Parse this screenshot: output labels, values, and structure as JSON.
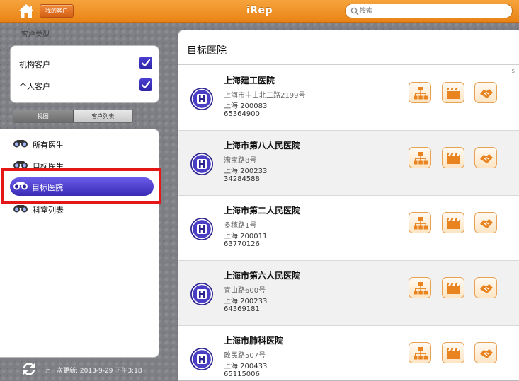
{
  "topbar": {
    "my_customers_label": "我的客户",
    "app_title": "iRep",
    "search_placeholder": "搜索"
  },
  "sidebar": {
    "section_label": "客户类型",
    "customer_types": [
      {
        "label": "机构客户",
        "checked": true
      },
      {
        "label": "个人客户",
        "checked": true
      }
    ],
    "segments": [
      "视图",
      "客户列表"
    ],
    "selected_segment": "视图",
    "nav_items": [
      {
        "label": "所有医生",
        "active": false
      },
      {
        "label": "目标医生",
        "active": false
      },
      {
        "label": "目标医院",
        "active": true
      },
      {
        "label": "科室列表",
        "active": false
      }
    ],
    "last_updated": "上一次更新: 2013-9-29 下午3:18"
  },
  "main": {
    "title": "目标医院",
    "index_marker": "S",
    "hospitals": [
      {
        "name": "上海建工医院",
        "address": "上海市中山北二路2199号",
        "city": "上海 200083",
        "phone": "65364900"
      },
      {
        "name": "上海市第八人民医院",
        "address": "漕宝路8号",
        "city": "上海 200233",
        "phone": "34284588"
      },
      {
        "name": "上海市第二人民医院",
        "address": "多稼路1号",
        "city": "上海 200011",
        "phone": "63770126"
      },
      {
        "name": "上海市第六人民医院",
        "address": "宜山路600号",
        "city": "上海 200233",
        "phone": "64369181"
      },
      {
        "name": "上海市肺科医院",
        "address": "政民路507号",
        "city": "上海 200433",
        "phone": "65115006"
      }
    ]
  },
  "colors": {
    "topbar": "#f29a2e",
    "accent_purple": "#3a2bb6",
    "action_orange": "#e8831f",
    "highlight_red": "#e51616"
  },
  "icons": [
    "home-icon",
    "search-icon",
    "checkmark-icon",
    "binoculars-icon",
    "hospital-icon",
    "org-chart-icon",
    "clapperboard-icon",
    "handshake-icon",
    "refresh-icon"
  ]
}
